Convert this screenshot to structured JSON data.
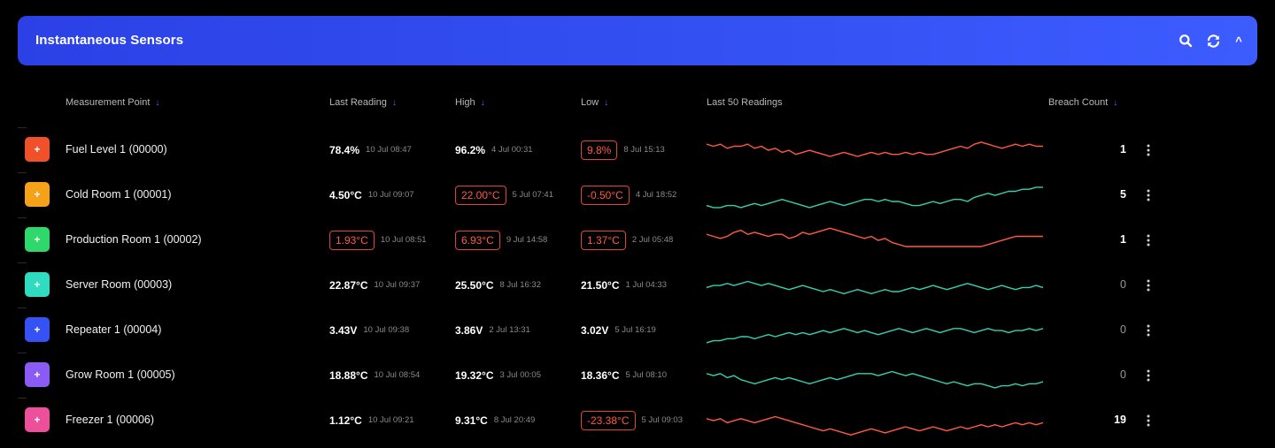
{
  "panel": {
    "title": "Instantaneous Sensors",
    "actions": {
      "search_icon": "search-icon",
      "refresh_icon": "refresh-icon",
      "collapse_label": "^"
    }
  },
  "columns": {
    "measurement_point": "Measurement Point",
    "last_reading": "Last Reading",
    "high": "High",
    "low": "Low",
    "last_50": "Last 50 Readings",
    "breach_count": "Breach Count",
    "sort_arrow": "↓"
  },
  "colors": {
    "header_start": "#2b41e6",
    "header_end": "#3d5cff",
    "breach_red": "#ff5a45",
    "normal_teal": "#35d0b0"
  },
  "rows": [
    {
      "tile_label": "+",
      "tile_color": "#f0512a",
      "name": "Fuel Level 1 (00000)",
      "last": "78.4%",
      "last_ts": "10 Jul 08:47",
      "last_breach": false,
      "high": "96.2%",
      "high_ts": "4 Jul 00:31",
      "high_breach": false,
      "low": "9.8%",
      "low_ts": "8 Jul 15:13",
      "low_breach": true,
      "spark_color": "#ff5a45",
      "breach_count": "1"
    },
    {
      "tile_label": "+",
      "tile_color": "#f5a11a",
      "name": "Cold Room 1 (00001)",
      "last": "4.50°C",
      "last_ts": "10 Jul 09:07",
      "last_breach": false,
      "high": "22.00°C",
      "high_ts": "5 Jul 07:41",
      "high_breach": true,
      "low": "-0.50°C",
      "low_ts": "4 Jul 18:52",
      "low_breach": true,
      "spark_color": "#35d0b0",
      "breach_count": "5"
    },
    {
      "tile_label": "+",
      "tile_color": "#2fd86a",
      "name": "Production Room 1 (00002)",
      "last": "1.93°C",
      "last_ts": "10 Jul 08:51",
      "last_breach": true,
      "high": "6.93°C",
      "high_ts": "9 Jul 14:58",
      "high_breach": true,
      "low": "1.37°C",
      "low_ts": "2 Jul 05:48",
      "low_breach": true,
      "spark_color": "#ff5a45",
      "breach_count": "1"
    },
    {
      "tile_label": "+",
      "tile_color": "#2fdcc0",
      "name": "Server Room (00003)",
      "last": "22.87°C",
      "last_ts": "10 Jul 09:37",
      "last_breach": false,
      "high": "25.50°C",
      "high_ts": "8 Jul 16:32",
      "high_breach": false,
      "low": "21.50°C",
      "low_ts": "1 Jul 04:33",
      "low_breach": false,
      "spark_color": "#35d0b0",
      "breach_count": "0"
    },
    {
      "tile_label": "+",
      "tile_color": "#3552f5",
      "name": "Repeater 1 (00004)",
      "last": "3.43V",
      "last_ts": "10 Jul 09:38",
      "last_breach": false,
      "high": "3.86V",
      "high_ts": "2 Jul 13:31",
      "high_breach": false,
      "low": "3.02V",
      "low_ts": "5 Jul 16:19",
      "low_breach": false,
      "spark_color": "#35d0b0",
      "breach_count": "0"
    },
    {
      "tile_label": "+",
      "tile_color": "#8a5cf5",
      "name": "Grow Room 1 (00005)",
      "last": "18.88°C",
      "last_ts": "10 Jul 08:54",
      "last_breach": false,
      "high": "19.32°C",
      "high_ts": "3 Jul 00:05",
      "high_breach": false,
      "low": "18.36°C",
      "low_ts": "5 Jul 08:10",
      "low_breach": false,
      "spark_color": "#35d0b0",
      "breach_count": "0"
    },
    {
      "tile_label": "+",
      "tile_color": "#ee4f9a",
      "name": "Freezer 1 (00006)",
      "last": "1.12°C",
      "last_ts": "10 Jul 09:21",
      "last_breach": false,
      "high": "9.31°C",
      "high_ts": "8 Jul 20:49",
      "high_breach": false,
      "low": "-23.38°C",
      "low_ts": "5 Jul 09:03",
      "low_breach": true,
      "spark_color": "#ff5a45",
      "breach_count": "19"
    }
  ]
}
